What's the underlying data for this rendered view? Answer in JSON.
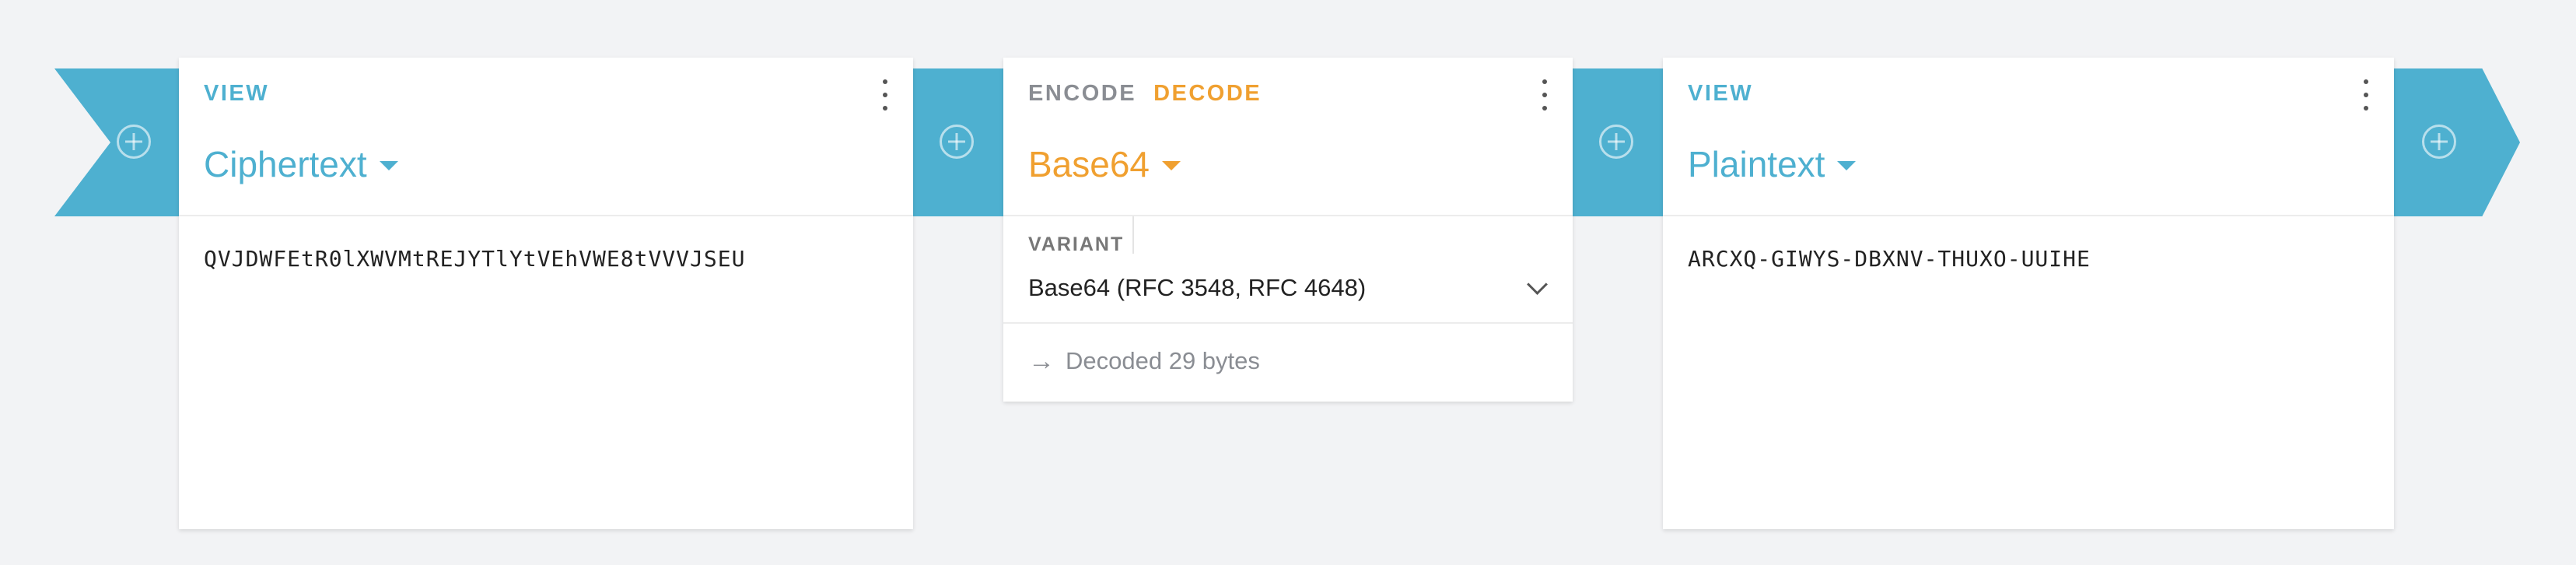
{
  "colors": {
    "pipeline": "#4eb0d0",
    "view_accent": "#4eb0d0",
    "decode_accent": "#f0a030",
    "background": "#f2f3f5"
  },
  "pipeline": {
    "add_icon": "plus-circle-icon"
  },
  "card_ciphertext": {
    "kind": "VIEW",
    "title": "Ciphertext",
    "content": "QVJDWFEtR0lXWVMtREJYTlYtVEhVWE8tVVVJSEU",
    "menu_icon": "more-vert-icon"
  },
  "card_base64": {
    "kind_encode": "ENCODE",
    "kind_decode": "DECODE",
    "active_kind": "DECODE",
    "title": "Base64",
    "variant_label": "VARIANT",
    "variant_value": "Base64 (RFC 3548, RFC 4648)",
    "status_icon": "arrow-right-icon",
    "status_text": "Decoded 29 bytes",
    "menu_icon": "more-vert-icon"
  },
  "card_plaintext": {
    "kind": "VIEW",
    "title": "Plaintext",
    "content": "ARCXQ-GIWYS-DBXNV-THUXO-UUIHE",
    "menu_icon": "more-vert-icon"
  }
}
